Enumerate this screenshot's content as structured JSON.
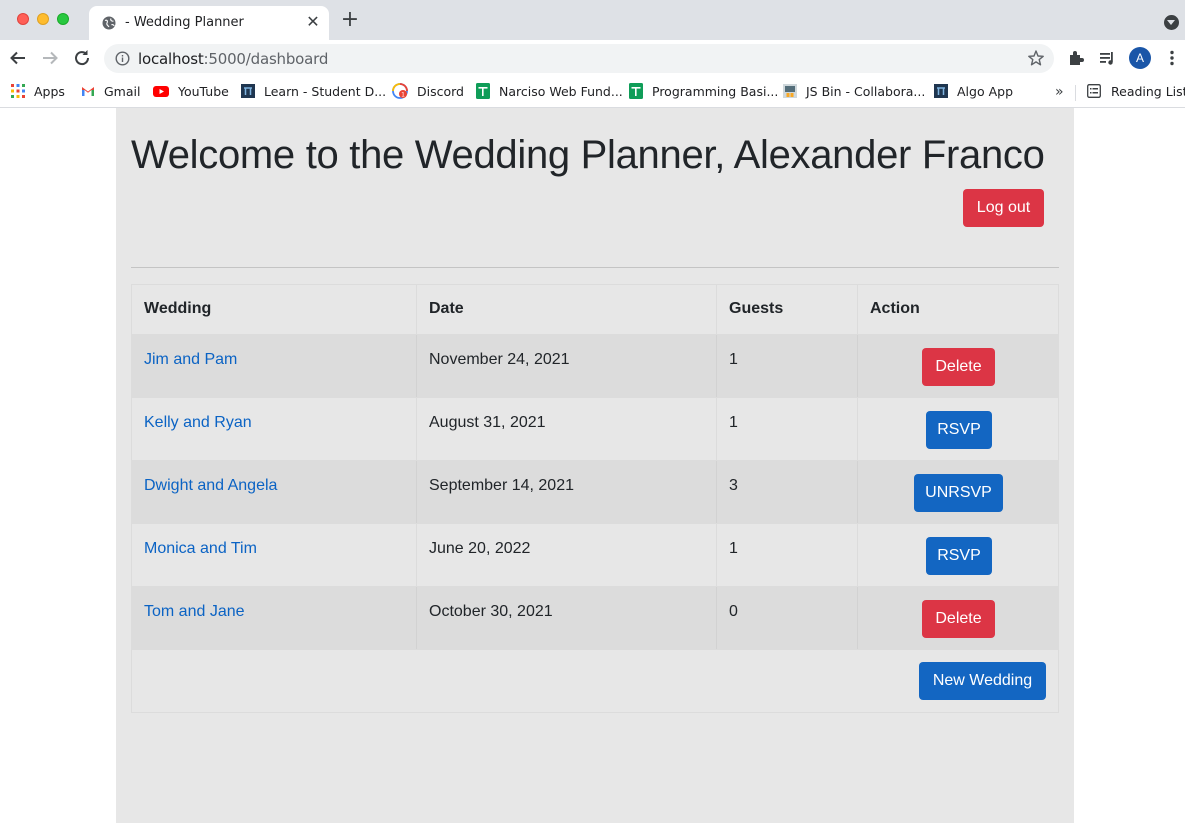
{
  "browser": {
    "tab_title": "- Wedding Planner",
    "url_host": "localhost",
    "url_path": ":5000/dashboard",
    "avatar_letter": "A",
    "bookmarks": [
      {
        "label": "Apps",
        "icon": "apps-grid-icon"
      },
      {
        "label": "Gmail",
        "icon": "gmail-icon"
      },
      {
        "label": "YouTube",
        "icon": "youtube-icon"
      },
      {
        "label": "Learn - Student D...",
        "icon": "learn-icon"
      },
      {
        "label": "Discord",
        "icon": "discord-icon"
      },
      {
        "label": "Narciso Web Fund...",
        "icon": "sheets-icon"
      },
      {
        "label": "Programming Basi...",
        "icon": "sheets-icon"
      },
      {
        "label": "JS Bin - Collabora...",
        "icon": "jsbin-icon"
      },
      {
        "label": "Algo App",
        "icon": "algo-icon"
      }
    ],
    "reading_list": "Reading List"
  },
  "page": {
    "heading": "Welcome to the Wedding Planner, Alexander Franco",
    "logout_label": "Log out",
    "table": {
      "headers": [
        "Wedding",
        "Date",
        "Guests",
        "Action"
      ],
      "rows": [
        {
          "wedding": "Jim and Pam",
          "date": "November 24, 2021",
          "guests": "1",
          "action": "Delete",
          "action_style": "danger"
        },
        {
          "wedding": "Kelly and Ryan",
          "date": "August 31, 2021",
          "guests": "1",
          "action": "RSVP",
          "action_style": "primary"
        },
        {
          "wedding": "Dwight and Angela",
          "date": "September 14, 2021",
          "guests": "3",
          "action": "UNRSVP",
          "action_style": "primary"
        },
        {
          "wedding": "Monica and Tim",
          "date": "June 20, 2022",
          "guests": "1",
          "action": "RSVP",
          "action_style": "primary"
        },
        {
          "wedding": "Tom and Jane",
          "date": "October 30, 2021",
          "guests": "0",
          "action": "Delete",
          "action_style": "danger"
        }
      ]
    },
    "new_wedding_label": "New Wedding"
  },
  "colors": {
    "danger": "#dc3545",
    "primary": "#1366c2",
    "link": "#0b63c4",
    "container_bg": "#e7e7e7"
  }
}
